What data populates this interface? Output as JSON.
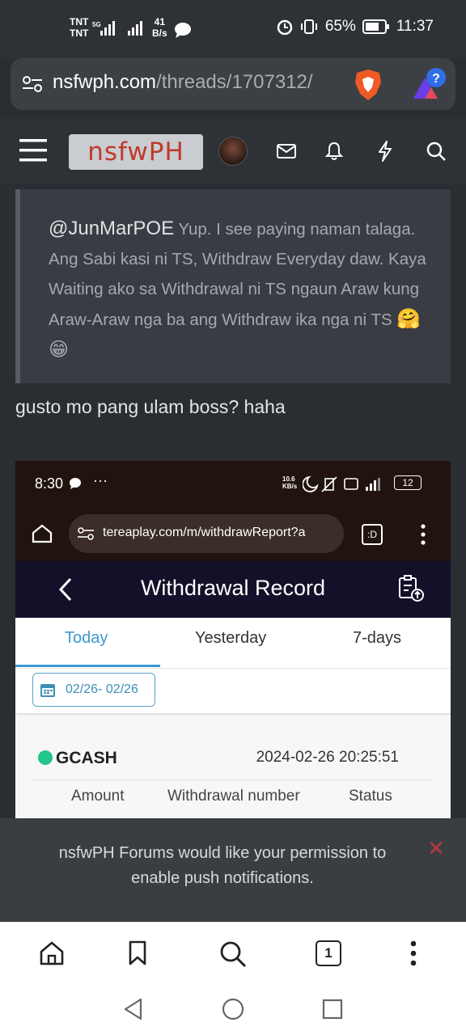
{
  "status_bar": {
    "carrier_1": "TNT",
    "carrier_2": "TNT",
    "net_type": "5G",
    "speed_value": "41",
    "speed_unit": "B/s",
    "battery": "65%",
    "time": "11:37"
  },
  "browser": {
    "url_domain": "nsfwph.com",
    "url_path": "/threads/1707312/"
  },
  "forum": {
    "logo_text": "nsfwPH"
  },
  "post": {
    "quote_mention": "@JunMarPOE",
    "quote_body": " Yup. I see paying naman talaga. Ang Sabi kasi ni TS, Withdraw Everyday daw. Kaya Waiting ako sa Withdrawal ni TS ngaun Araw kung Araw-Araw nga ba ang Withdraw ika nga ni TS ",
    "quote_emoji": "🤗😁",
    "reply_text": "gusto mo pang ulam boss? haha"
  },
  "embedded_screenshot": {
    "time": "8:30",
    "more": "···",
    "speed": "10.6\nKB/s",
    "battery": "12",
    "url": "tereaplay.com/m/withdrawReport?a",
    "tab_count": ":D",
    "page_title": "Withdrawal Record",
    "tabs": [
      "Today",
      "Yesterday",
      "7-days"
    ],
    "date_range": "02/26- 02/26",
    "method": "GCASH",
    "datetime": "2024-02-26 20:25:51",
    "columns": [
      "Amount",
      "Withdrawal number",
      "Status"
    ]
  },
  "notification": {
    "text": "nsfwPH Forums would like your permission to enable push notifications.",
    "close_glyph": "✕"
  },
  "toolbar": {
    "tabs_count": "1"
  },
  "colors": {
    "page_bg": "#2a2d31",
    "logo_red": "#c0392b",
    "tab_active": "#3d9ad0",
    "gcash_green": "#22c58a"
  }
}
